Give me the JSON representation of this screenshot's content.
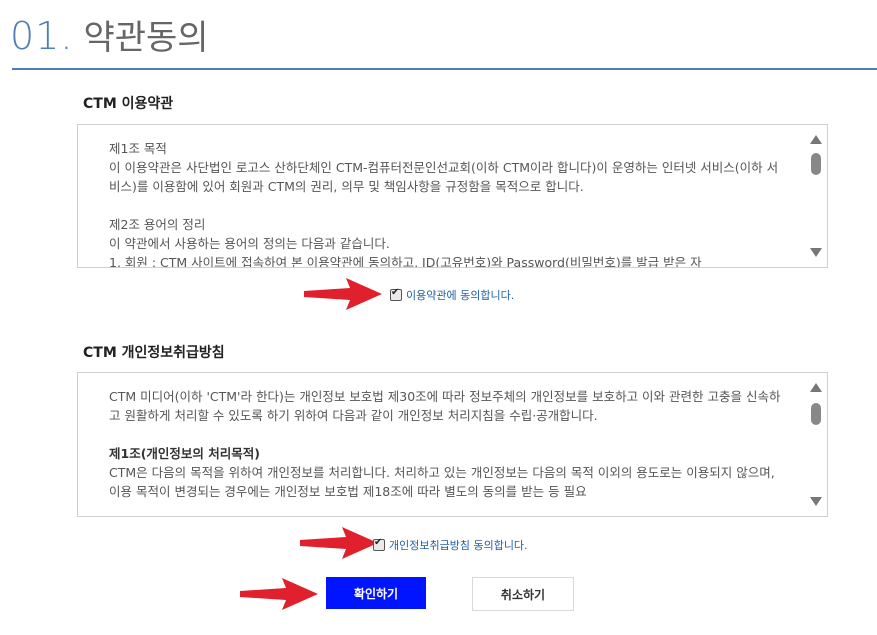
{
  "header": {
    "number": "01.",
    "title": "약관동의"
  },
  "terms": {
    "heading": "CTM 이용약관",
    "text": "제1조 목적\n이 이용약관은 사단법인 로고스 산하단체인 CTM-컴퓨터전문인선교회(이하 CTM이라 합니다)이 운영하는 인터넷 서비스(이하 서비스)를 이용함에 있어 회원과 CTM의 권리, 의무 및 책임사항을 규정함을 목적으로 합니다.\n\n제2조 용어의 정리\n이 약관에서 사용하는 용어의 정의는 다음과 같습니다.\n1. 회원 : CTM 사이트에 접속하여 본 이용약관에 동의하고, ID(고유번호)와 Password(비밀번호)를 발급 받은 자",
    "agree_label": "이용약관에 동의합니다."
  },
  "privacy": {
    "heading": "CTM 개인정보취급방침",
    "intro": "CTM 미디어(이하 'CTM'라 한다)는 개인정보 보호법 제30조에 따라 정보주체의 개인정보를 보호하고 이와 관련한 고충을 신속하고 원활하게 처리할 수 있도록 하기 위하여 다음과 같이 개인정보 처리지침을 수립·공개합니다.",
    "article_title": "제1조(개인정보의 처리목적)",
    "article_text": "CTM은 다음의 목적을 위하여 개인정보를 처리합니다. 처리하고 있는 개인정보는 다음의 목적 이외의 용도로는 이용되지 않으며, 이용 목적이 변경되는 경우에는 개인정보 보호법 제18조에 따라 별도의 동의를 받는 등 필요",
    "agree_label": "개인정보취급방침 동의합니다."
  },
  "buttons": {
    "confirm": "확인하기",
    "cancel": "취소하기"
  },
  "colors": {
    "accent": "#4f7db8",
    "confirm_bg": "#0014ff",
    "arrow": "#e0202c",
    "link": "#1f5fa8"
  }
}
